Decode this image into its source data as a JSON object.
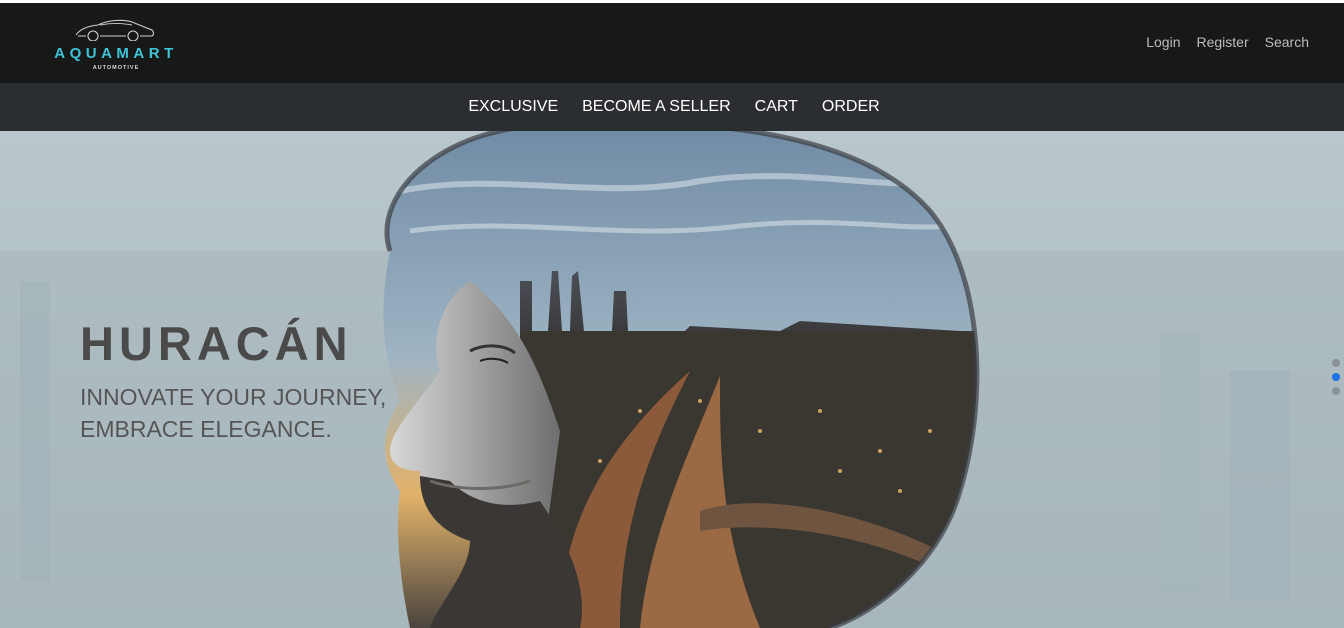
{
  "brand": {
    "name": "AQUAMART",
    "tagline": "AUTOMOTIVE",
    "accent_color": "#3fc3d6",
    "icon": "sports-car-outline-icon"
  },
  "auth": {
    "login": "Login",
    "register": "Register",
    "search": "Search"
  },
  "nav": {
    "items": [
      {
        "label": "EXCLUSIVE"
      },
      {
        "label": "BECOME A SELLER"
      },
      {
        "label": "CART"
      },
      {
        "label": "ORDER"
      }
    ]
  },
  "hero": {
    "title": "HURACÁN",
    "subtitle_line1": "INNOVATE YOUR JOURNEY,",
    "subtitle_line2": "EMBRACE ELEGANCE.",
    "image": "double-exposure-bearded-man-city-highway",
    "slides": {
      "count": 3,
      "active_index": 1,
      "active_color": "#1b74e4"
    }
  }
}
